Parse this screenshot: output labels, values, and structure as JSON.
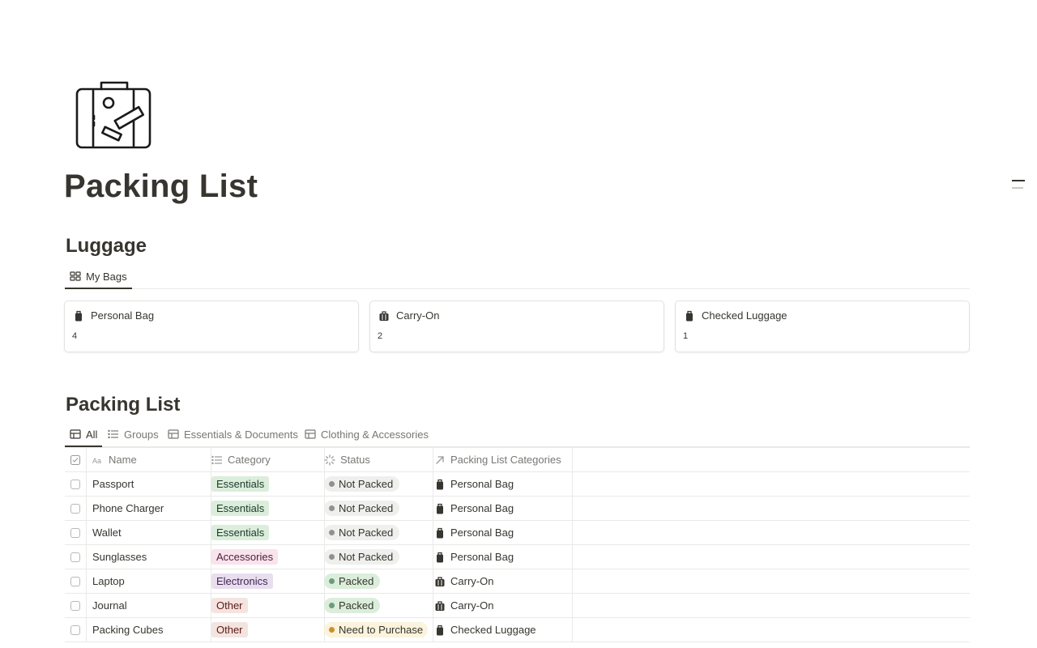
{
  "page": {
    "title": "Packing List"
  },
  "luggage": {
    "title": "Luggage",
    "view_label": "My Bags",
    "cards": [
      {
        "label": "Personal Bag",
        "count": "4",
        "icon": "bag-icon"
      },
      {
        "label": "Carry-On",
        "count": "2",
        "icon": "suitcase-icon"
      },
      {
        "label": "Checked Luggage",
        "count": "1",
        "icon": "bag-icon"
      }
    ]
  },
  "packing": {
    "title": "Packing List",
    "tabs": [
      {
        "label": "All",
        "active": true
      },
      {
        "label": "Groups",
        "active": false
      },
      {
        "label": "Essentials & Documents",
        "active": false
      },
      {
        "label": "Clothing & Accessories",
        "active": false
      }
    ],
    "columns": {
      "name": "Name",
      "category": "Category",
      "status": "Status",
      "packing_categories": "Packing List Categories"
    },
    "rows": [
      {
        "name": "Passport",
        "category": "Essentials",
        "status": "Not Packed",
        "bag": "Personal Bag"
      },
      {
        "name": "Phone Charger",
        "category": "Essentials",
        "status": "Not Packed",
        "bag": "Personal Bag"
      },
      {
        "name": "Wallet",
        "category": "Essentials",
        "status": "Not Packed",
        "bag": "Personal Bag"
      },
      {
        "name": "Sunglasses",
        "category": "Accessories",
        "status": "Not Packed",
        "bag": "Personal Bag"
      },
      {
        "name": "Laptop",
        "category": "Electronics",
        "status": "Packed",
        "bag": "Carry-On"
      },
      {
        "name": "Journal",
        "category": "Other",
        "status": "Packed",
        "bag": "Carry-On"
      },
      {
        "name": "Packing Cubes",
        "category": "Other",
        "status": "Need to Purchase",
        "bag": "Checked Luggage"
      }
    ]
  },
  "colors": {
    "text": "#37352f",
    "muted": "#787774",
    "tag_essentials_bg": "#dbeddb",
    "tag_essentials_fg": "#1c3829",
    "tag_accessories_bg": "#f9e3ec",
    "tag_accessories_fg": "#4c2337",
    "tag_electronics_bg": "#e8deee",
    "tag_electronics_fg": "#412454",
    "tag_other_bg": "#f4e4e0",
    "tag_other_fg": "#5d1715",
    "status_not_packed_bg": "#efefed",
    "status_not_packed_dot": "#91918e",
    "status_packed_bg": "#dbeddb",
    "status_packed_dot": "#6c9b7d",
    "status_purchase_bg": "#fbf3db",
    "status_purchase_dot": "#cb912f"
  }
}
